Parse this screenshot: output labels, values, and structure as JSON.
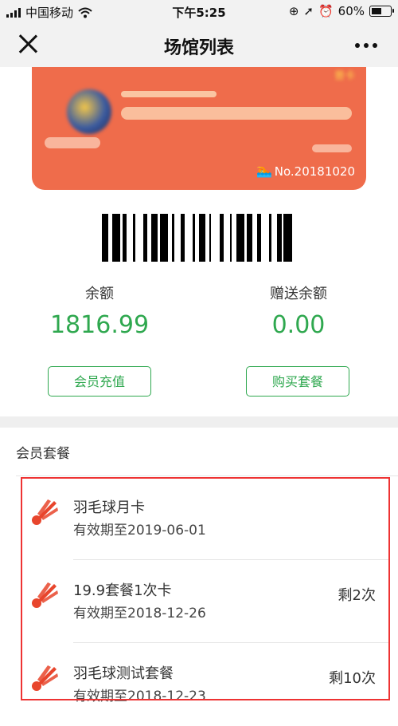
{
  "status_bar": {
    "carrier": "中国移动",
    "time": "下午5:25",
    "battery": "60%",
    "battery_level": 0.6
  },
  "nav": {
    "title": "场馆列表"
  },
  "card": {
    "tag": "普卡",
    "number": "No.20181020"
  },
  "balance": {
    "label": "余额",
    "value": "1816.99"
  },
  "gift_balance": {
    "label": "赠送余额",
    "value": "0.00"
  },
  "buttons": {
    "recharge": "会员充值",
    "buy_package": "购买套餐"
  },
  "section_title": "会员套餐",
  "packages": [
    {
      "name": "羽毛球月卡",
      "valid": "有效期至2019-06-01",
      "remaining": ""
    },
    {
      "name": "19.9套餐1次卡",
      "valid": "有效期至2018-12-26",
      "remaining": "剩2次"
    },
    {
      "name": "羽毛球测试套餐",
      "valid": "有效期至2018-12-23",
      "remaining": "剩10次"
    }
  ],
  "colors": {
    "accent_green": "#2fa84f",
    "card_orange": "#ef6c4b",
    "shuttlecock": "#e8452c",
    "highlight_red": "#ee3333"
  }
}
